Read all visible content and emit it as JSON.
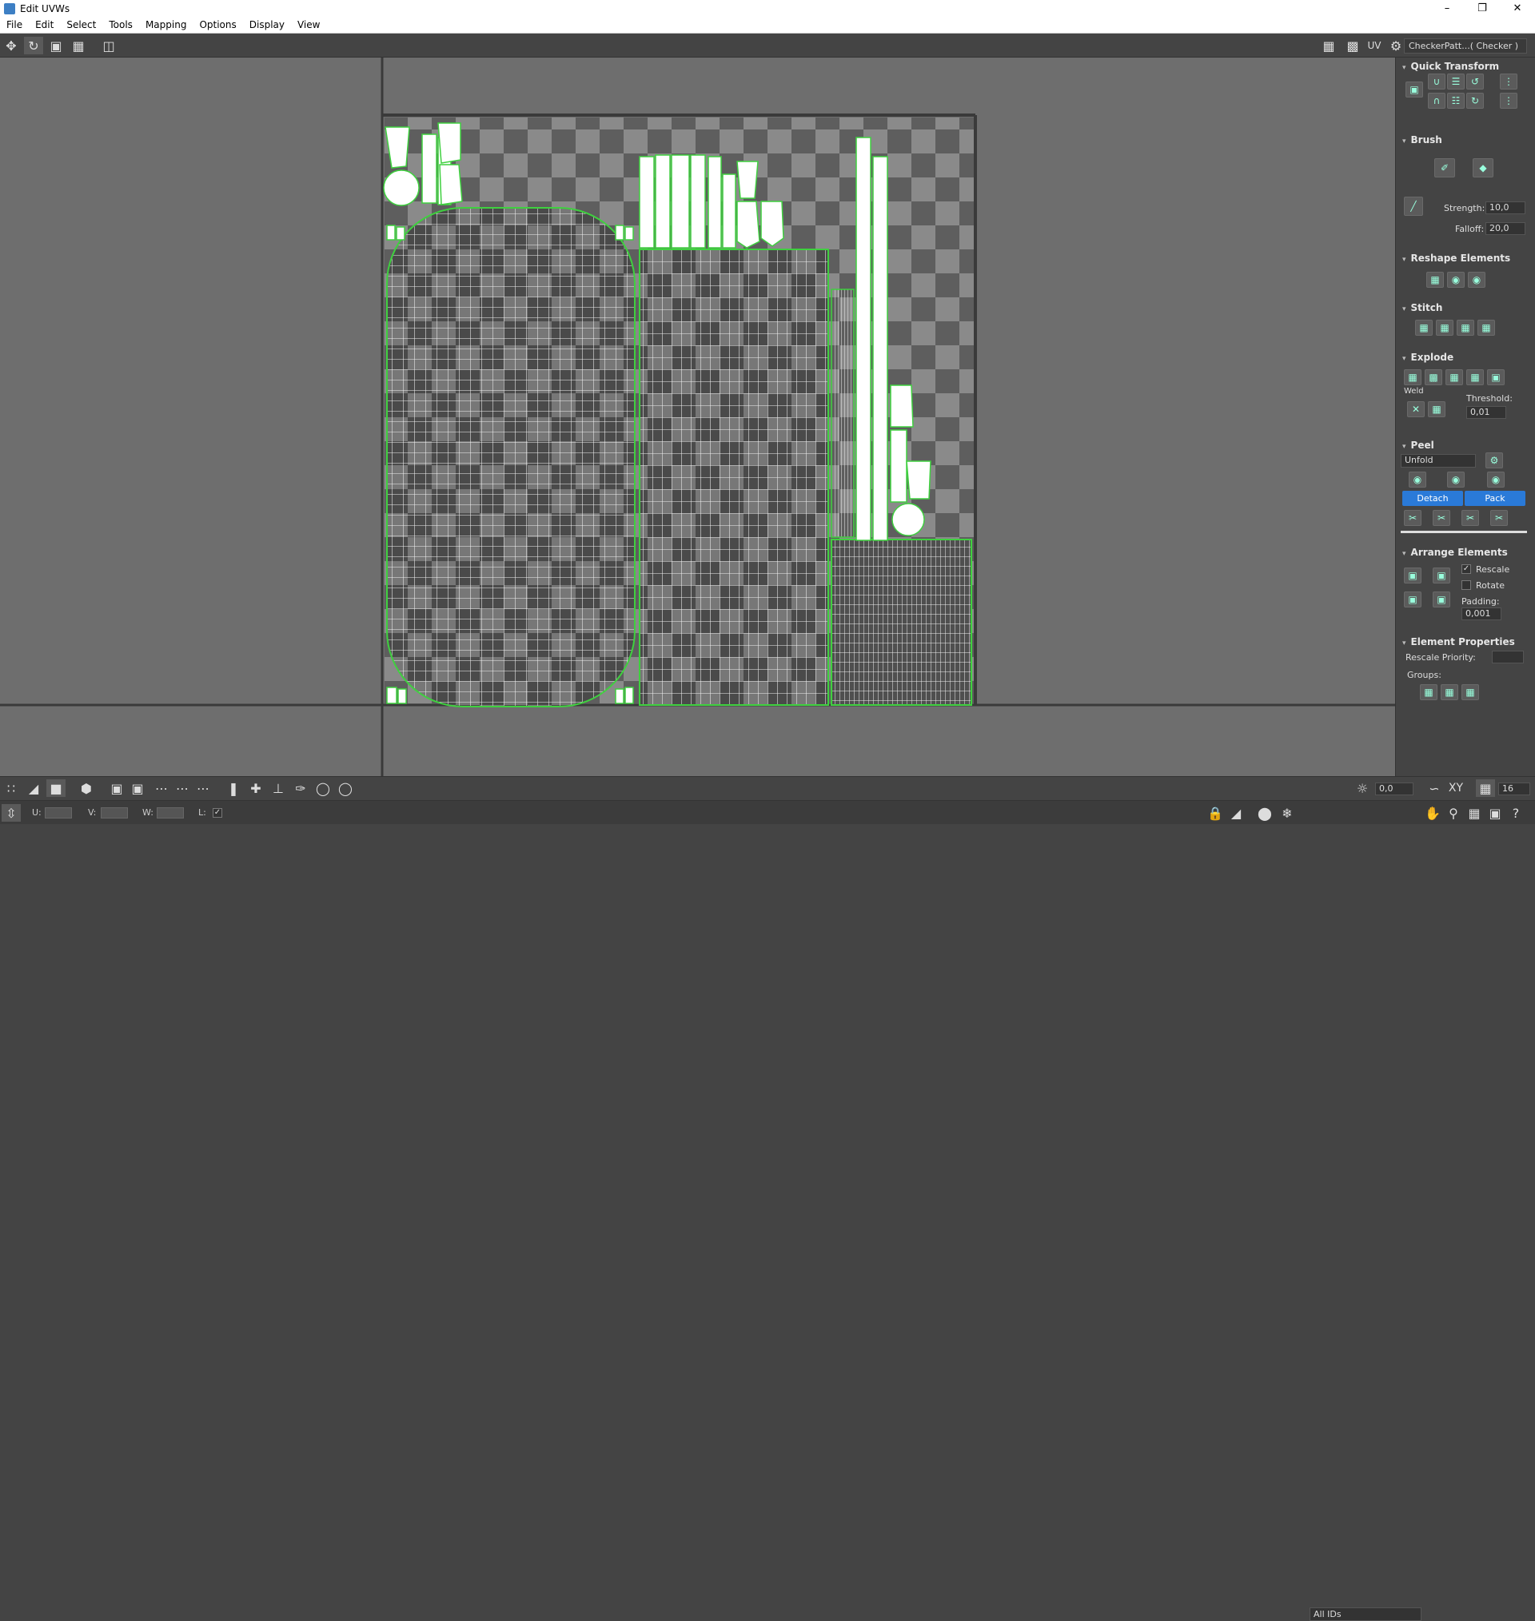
{
  "window": {
    "title": "Edit UVWs",
    "min": "–",
    "max": "❐",
    "close": "✕"
  },
  "menu": [
    "File",
    "Edit",
    "Select",
    "Tools",
    "Mapping",
    "Options",
    "Display",
    "View"
  ],
  "toolbar": {
    "uv_label": "UV",
    "texture_select": "CheckerPatt...( Checker )"
  },
  "panel": {
    "quick_transform": "Quick Transform",
    "brush": {
      "title": "Brush",
      "strength_label": "Strength:",
      "strength": "10,0",
      "falloff_label": "Falloff:",
      "falloff": "20,0"
    },
    "reshape": "Reshape Elements",
    "stitch": "Stitch",
    "explode": {
      "title": "Explode",
      "weld": "Weld",
      "threshold_label": "Threshold:",
      "threshold": "0,01"
    },
    "peel": {
      "title": "Peel",
      "mode": "Unfold",
      "detach": "Detach",
      "pack": "Pack"
    },
    "arrange": {
      "title": "Arrange Elements",
      "rescale": "Rescale",
      "rotate": "Rotate",
      "padding_label": "Padding:",
      "padding": "0,001"
    },
    "element_props": {
      "title": "Element Properties",
      "rescale_priority": "Rescale Priority:",
      "groups": "Groups:"
    }
  },
  "bottom": {
    "angle": "0,0",
    "xy": "XY",
    "grid": "16"
  },
  "status": {
    "u": "U:",
    "v": "V:",
    "w": "W:",
    "l": "L:",
    "ids": "All IDs"
  }
}
